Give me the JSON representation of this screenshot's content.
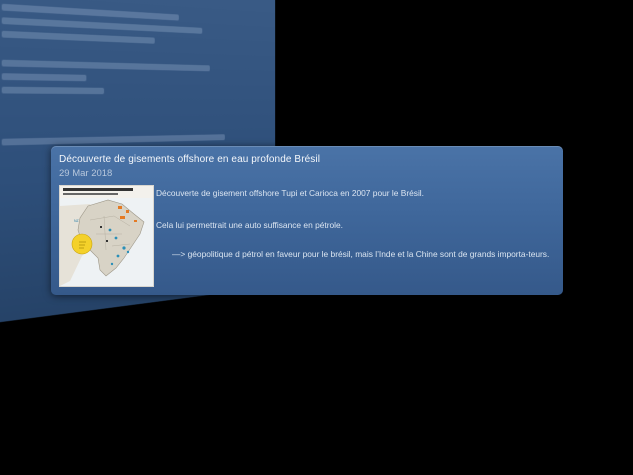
{
  "card": {
    "title": "Découverte de gisements offshore en eau profonde Brésil",
    "date": "29 Mar 2018",
    "paragraphs": [
      "Découverte de gisement offshore Tupi et Carioca en 2007 pour le Brésil.",
      "Cela lui permettrait une auto suffisance en pétrole.",
      "—> géopolitique d pétrol en faveur pour le brésil, mais l’Inde et la Chine sont de grands importa-teurs."
    ]
  }
}
